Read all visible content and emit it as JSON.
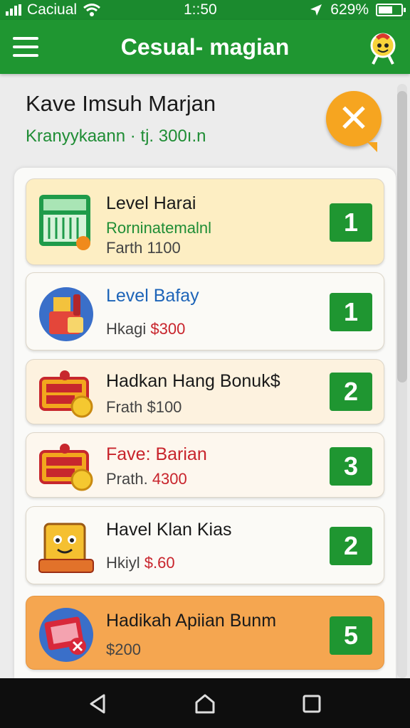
{
  "status": {
    "carrier": "Caciual",
    "time": "1::50",
    "battery": "629%",
    "battery_level": 0.62
  },
  "header": {
    "title": "Cesual- magian",
    "menu_icon": "hamburger-icon",
    "avatar_icon": "mascot-icon"
  },
  "promo": {
    "title": "Kave Imsuh Marjan",
    "subtitle": "Kranyykaann · tj. 300ı.n",
    "close_icon": "close-icon"
  },
  "levels": [
    {
      "title": "Level Harai",
      "subtitle": "Rorninatemalnl",
      "meta_prefix": "Farth ",
      "meta_amount": "1100",
      "badge": "1",
      "icon": "cash-register-icon",
      "bg": "#fdeec3",
      "title_color": "#1a1a1a"
    },
    {
      "title": "Level Bafay",
      "meta_prefix": "Hkagi ",
      "meta_amount": "$300",
      "badge": "1",
      "icon": "shopping-basket-icon",
      "bg": "#fbfaf6",
      "title_color": "#1d64b8"
    },
    {
      "title": "Hadkan Hang Bonuk$",
      "meta_prefix": "Frath ",
      "meta_amount": "$100",
      "badge": "2",
      "icon": "bonus-sign-icon",
      "bg": "#fdf2df",
      "title_color": "#1a1a1a"
    },
    {
      "title": "Fave: Barian",
      "meta_prefix": "Prath. ",
      "meta_amount": "4300",
      "badge": "3",
      "icon": "bonus-sign-icon",
      "bg": "#fdf7ee",
      "title_color": "#c8242c"
    },
    {
      "title": "Havel Klan Kias",
      "meta_prefix": "Hkiyl ",
      "meta_amount": "$.60",
      "badge": "2",
      "icon": "box-character-icon",
      "bg": "#fbfaf6",
      "title_color": "#1a1a1a"
    },
    {
      "title": "Hadikah Apiian Bunm",
      "meta_prefix": "",
      "meta_amount": "$200",
      "badge": "5",
      "icon": "ticket-card-icon",
      "bg": "#f5a650",
      "title_color": "#1a1a1a"
    }
  ],
  "nav": {
    "back_icon": "back-icon",
    "home_icon": "home-icon",
    "recents_icon": "recents-icon"
  }
}
